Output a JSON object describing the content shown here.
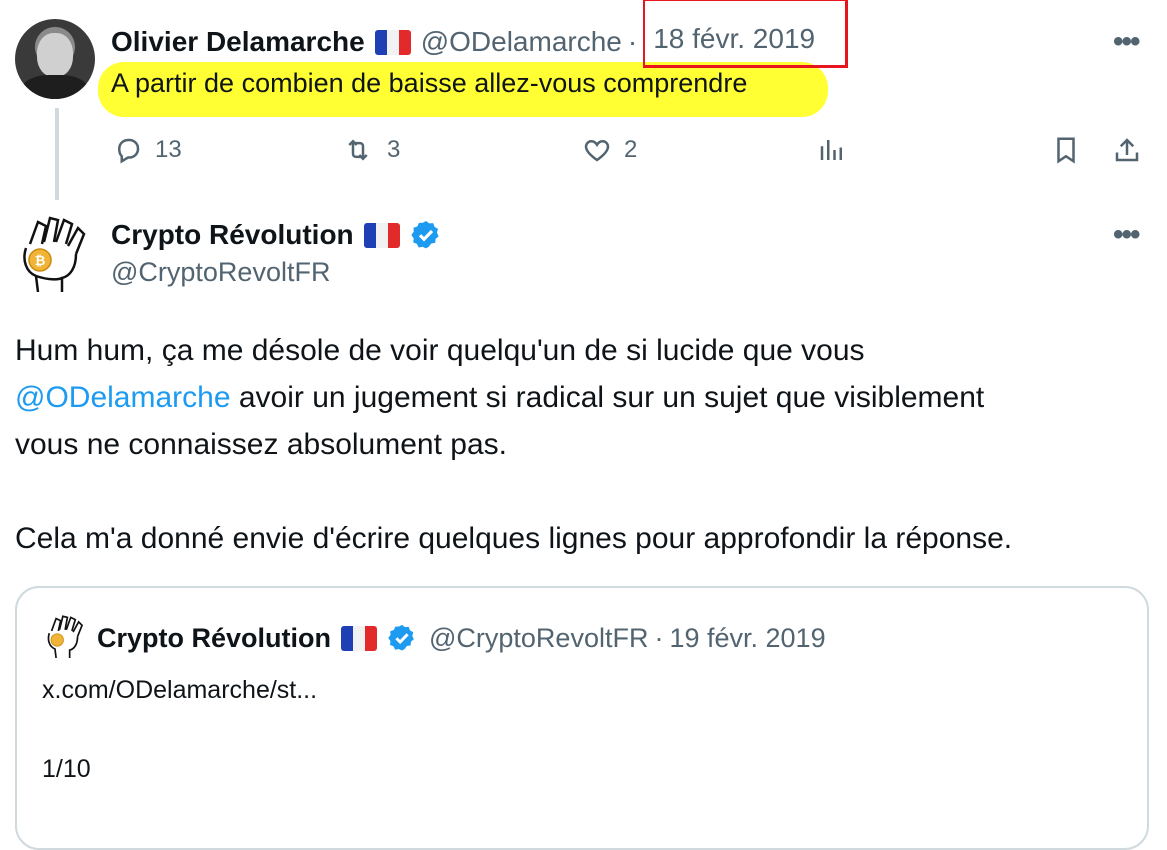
{
  "reply_tweet": {
    "display_name": "Olivier Delamarche",
    "handle": "@ODelamarche",
    "separator": "·",
    "date": "18 févr. 2019",
    "text": "A partir de combien de baisse allez-vous comprendre",
    "stats": {
      "replies": "13",
      "retweets": "3",
      "likes": "2"
    }
  },
  "main_tweet": {
    "display_name": "Crypto Révolution",
    "handle": "@CryptoRevoltFR",
    "text_part1": "Hum hum, ça me désole de voir quelqu'un de si lucide que vous",
    "mention": "@ODelamarche",
    "text_part2": " avoir un jugement si radical sur un sujet que visiblement",
    "text_part3": "vous ne connaissez absolument pas.",
    "text_part4": "Cela m'a donné envie d'écrire quelques lignes pour approfondir la réponse."
  },
  "quoted_tweet": {
    "display_name": "Crypto Révolution",
    "handle": "@CryptoRevoltFR",
    "separator": "·",
    "date": "19 févr. 2019",
    "link": "x.com/ODelamarche/st...",
    "counter": "1/10"
  },
  "more_glyph": "•••",
  "colors": {
    "link": "#1d9bf0",
    "highlight": "#ffff33",
    "annotation_box": "#e8141e",
    "verified": "#1d9bf0"
  },
  "icons": [
    "reply-icon",
    "retweet-icon",
    "like-icon",
    "views-icon",
    "bookmark-icon",
    "share-icon",
    "verified-badge-icon",
    "french-flag-icon",
    "more-options-icon"
  ]
}
